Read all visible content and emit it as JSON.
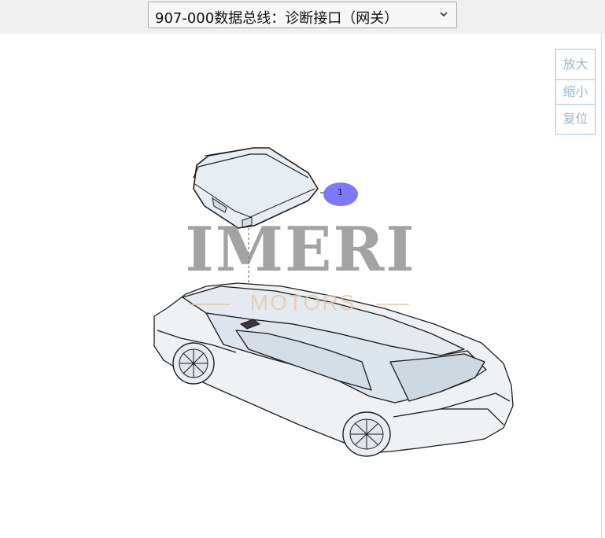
{
  "toolbar": {
    "diagram_select_value": "907-000数据总线：诊断接口（网关）"
  },
  "zoom": {
    "zoom_in_label": "放大",
    "zoom_out_label": "缩小",
    "reset_label": "复位"
  },
  "diagram": {
    "callouts": [
      {
        "number": "1"
      }
    ],
    "watermark_logo_text": "IMERI",
    "watermark_sub_text": "MOTORS"
  },
  "colors": {
    "callout_fill": "#7e78f8",
    "part_fill": "#e6eef4",
    "outline": "#1c1c1c",
    "zoom_border": "#9fc7e6",
    "zoom_text": "#9ab8cf"
  }
}
